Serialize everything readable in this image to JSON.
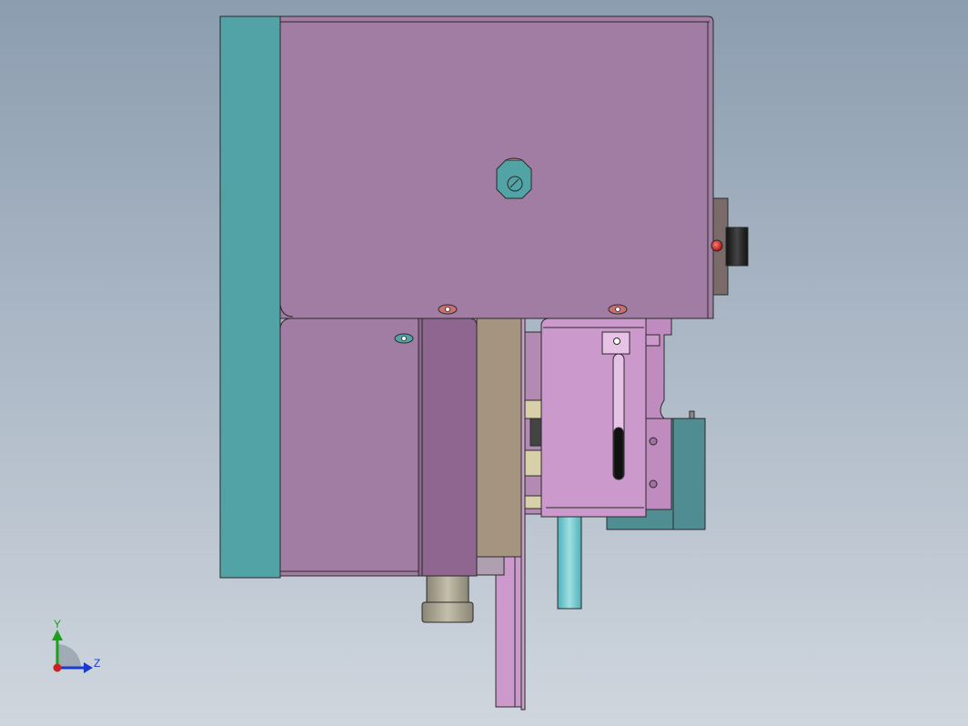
{
  "viewport": {
    "background_top": "#8c9db0",
    "background_bottom": "#cfd6de"
  },
  "colors": {
    "teal_plate": "#52a3a5",
    "purple_plate": "#a17ca3",
    "purple_dark": "#8e6690",
    "tan_block": "#a59480",
    "pink_bracket": "#cc99cc",
    "teal_motor": "#4f8d93",
    "cyan_rod": "#66c2c8",
    "knob_gray": "#aaa490",
    "red_dot": "#c83030"
  },
  "triad": {
    "y_label": "Y",
    "z_label": "Z",
    "y_color": "#1aa01a",
    "z_color": "#1a3ad0",
    "origin_color": "#d02020"
  }
}
